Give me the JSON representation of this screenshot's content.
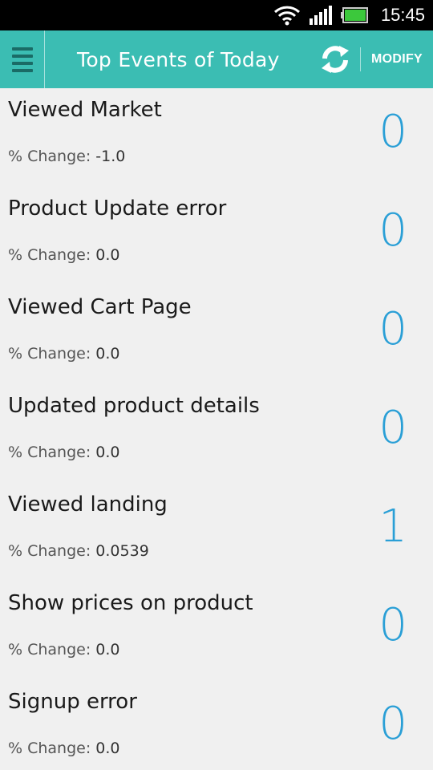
{
  "status_bar": {
    "time": "15:45",
    "icons": [
      "wifi-icon",
      "signal-icon",
      "battery-icon"
    ]
  },
  "action_bar": {
    "title": "Top Events of Today",
    "modify_label": "MODIFY",
    "icons": [
      "menu-icon",
      "refresh-icon"
    ],
    "accent_color": "#3bbdb3"
  },
  "events": [
    {
      "name": "Viewed Market",
      "change_label": "% Change:",
      "change_value": "-1.0",
      "count": "0"
    },
    {
      "name": "Product Update error",
      "change_label": "% Change:",
      "change_value": "0.0",
      "count": "0"
    },
    {
      "name": "Viewed Cart Page",
      "change_label": "% Change:",
      "change_value": "0.0",
      "count": "0"
    },
    {
      "name": "Updated product details",
      "change_label": "% Change:",
      "change_value": "0.0",
      "count": "0"
    },
    {
      "name": "Viewed landing",
      "change_label": "% Change:",
      "change_value": "0.0539",
      "count": "1"
    },
    {
      "name": "Show prices on product",
      "change_label": "% Change:",
      "change_value": "0.0",
      "count": "0"
    },
    {
      "name": "Signup error",
      "change_label": "% Change:",
      "change_value": "0.0",
      "count": "0"
    }
  ],
  "colors": {
    "count": "#2a9fd6",
    "background": "#f0f0f0"
  }
}
